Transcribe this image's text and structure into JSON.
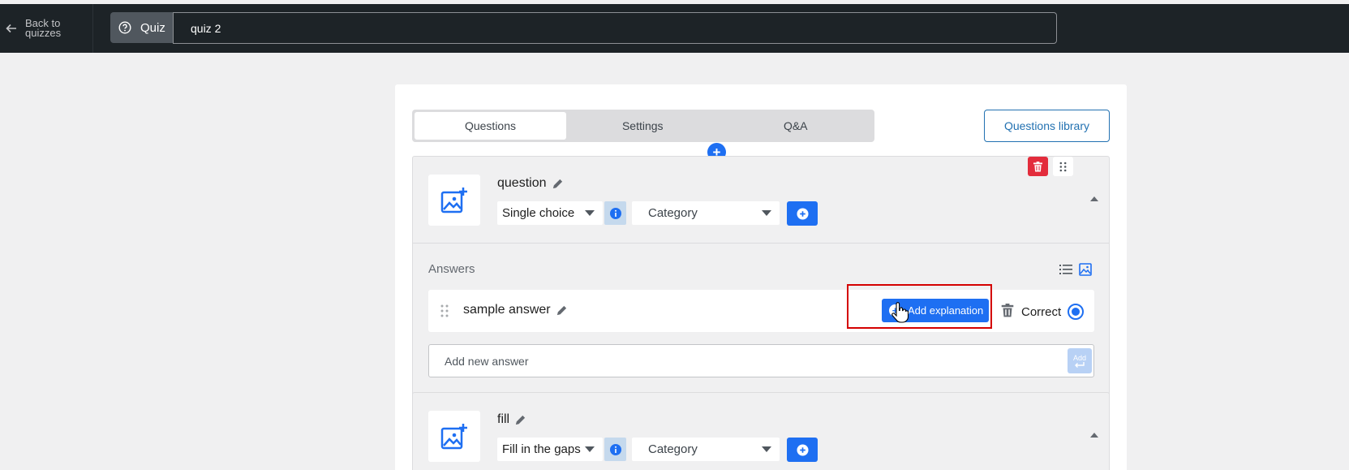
{
  "topbar": {
    "back_label": "Back to quizzes",
    "quiz_label": "Quiz",
    "quiz_title_value": "quiz 2"
  },
  "tabs": [
    {
      "label": "Questions",
      "active": true
    },
    {
      "label": "Settings",
      "active": false
    },
    {
      "label": "Q&A",
      "active": false
    }
  ],
  "library_button": "Questions library",
  "questions": [
    {
      "title": "question",
      "type": "Single choice",
      "category_placeholder": "Category",
      "answers_label": "Answers",
      "answers": [
        {
          "text": "sample answer",
          "explanation_button": "Add explanation",
          "correct_label": "Correct",
          "correct": true
        }
      ],
      "new_answer_placeholder": "Add new answer",
      "add_button": "Add"
    },
    {
      "title": "fill",
      "type": "Fill in the gaps",
      "category_placeholder": "Category"
    }
  ],
  "colors": {
    "topbar": "#1d2327",
    "accent": "#1e6ff2",
    "danger": "#e32c3c",
    "highlight": "#d40000"
  },
  "icons": [
    "arrow-left-icon",
    "question-circle-icon",
    "image-add-icon",
    "pencil-icon",
    "info-icon",
    "plus-icon",
    "trash-icon",
    "drag-grid-icon",
    "chevron-up-icon",
    "list-view-icon",
    "image-view-icon",
    "drag-handle-icon",
    "enter-icon",
    "hand-cursor-icon"
  ]
}
